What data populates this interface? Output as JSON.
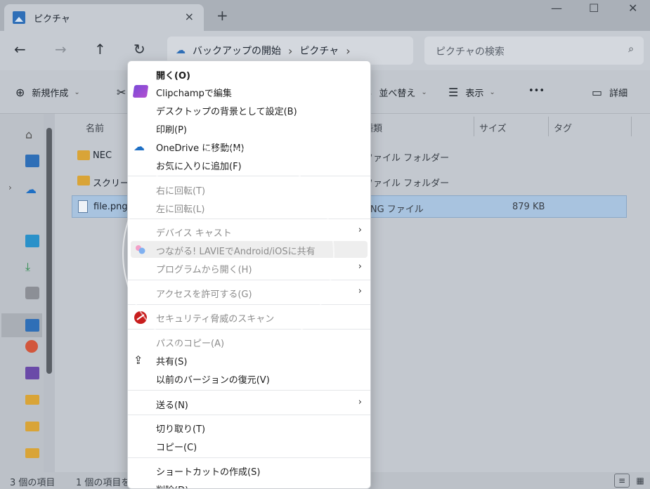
{
  "window": {
    "tab_title": "ピクチャ",
    "close_tab": "×",
    "new_tab": "+",
    "minimize": "—",
    "maximize": "☐",
    "close": "✕"
  },
  "nav": {
    "back": "←",
    "forward": "→",
    "up": "↑",
    "refresh": "↻",
    "breadcrumb": [
      "バックアップの開始",
      "ピクチャ"
    ],
    "search_placeholder": "ピクチャの検索"
  },
  "commandbar": {
    "new": "新規作成",
    "sort": "並べ替え",
    "view": "表示",
    "more": "•••",
    "details": "詳細"
  },
  "columns": {
    "name": "名前",
    "type": "種類",
    "size": "サイズ",
    "tag": "タグ"
  },
  "files": [
    {
      "name": "NEC",
      "type": "ファイル フォルダー",
      "size": "",
      "kind": "folder"
    },
    {
      "name": "スクリーン",
      "type": "ファイル フォルダー",
      "size": "",
      "kind": "folder"
    },
    {
      "name": "file.png",
      "type": "PNG ファイル",
      "size": "879 KB",
      "kind": "file"
    }
  ],
  "status": {
    "count": "3 個の項目",
    "selected": "1 個の項目を"
  },
  "menu": {
    "items": [
      {
        "label": "開く(O)"
      },
      {
        "label": "Clipchampで編集"
      },
      {
        "label": "デスクトップの背景として設定(B)"
      },
      {
        "label": "印刷(P)"
      },
      {
        "label": "OneDrive に移動(M)"
      },
      {
        "label": "お気に入りに追加(F)"
      },
      {
        "label": "右に回転(T)"
      },
      {
        "label": "左に回転(L)"
      },
      {
        "label": "デバイス キャスト"
      },
      {
        "label": "つながる! LAVIEでAndroid/iOSに共有"
      },
      {
        "label": "プログラムから開く(H)"
      },
      {
        "label": "アクセスを許可する(G)"
      },
      {
        "label": "セキュリティ脅威のスキャン"
      },
      {
        "label": "パスのコピー(A)"
      },
      {
        "label": "共有(S)"
      },
      {
        "label": "以前のバージョンの復元(V)"
      },
      {
        "label": "送る(N)"
      },
      {
        "label": "切り取り(T)"
      },
      {
        "label": "コピー(C)"
      },
      {
        "label": "ショートカットの作成(S)"
      },
      {
        "label": "削除(D)"
      }
    ],
    "submenu_arrow": "›"
  },
  "colors": {
    "accent": "#2f6fb7",
    "folder": "#d9a437",
    "selection": "#a8c3df",
    "menu_bg": "#ffffff"
  }
}
